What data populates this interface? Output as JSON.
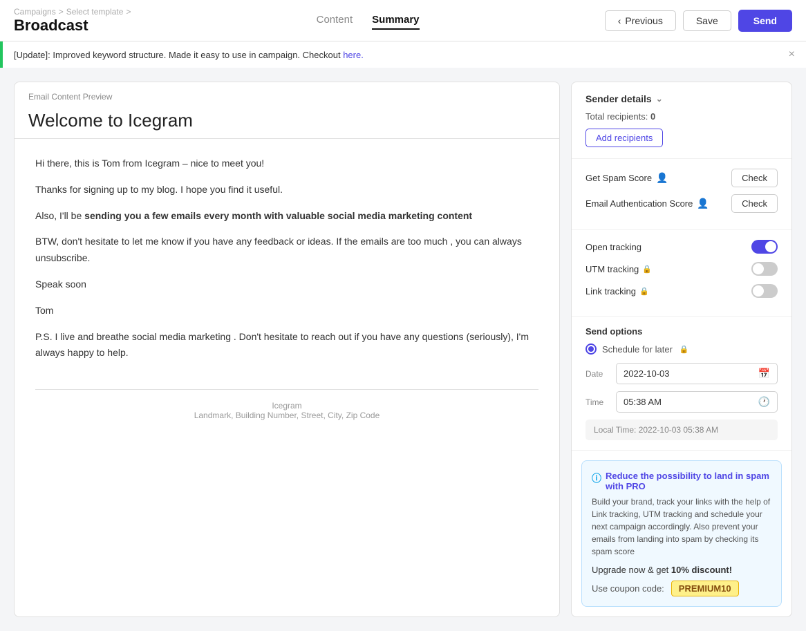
{
  "breadcrumb": {
    "campaigns": "Campaigns",
    "sep1": ">",
    "select_template": "Select template",
    "sep2": ">"
  },
  "page": {
    "title": "Broadcast"
  },
  "tabs": [
    {
      "id": "content",
      "label": "Content",
      "active": false
    },
    {
      "id": "summary",
      "label": "Summary",
      "active": true
    }
  ],
  "header_buttons": {
    "previous": "Previous",
    "save": "Save",
    "send": "Send"
  },
  "banner": {
    "text": "[Update]: Improved keyword structure. Made it easy to use in campaign. Checkout ",
    "link_text": "here.",
    "close": "×"
  },
  "preview": {
    "label": "Email Content Preview",
    "email_title": "Welcome to Icegram",
    "body_paragraphs": [
      "Hi there, this is Tom from Icegram – nice to meet you!",
      "Thanks for signing up to my blog. I hope you find it useful.",
      "",
      "BTW, don't hesitate to let me know if you have any feedback or ideas. If the emails are too much , you can always unsubscribe.",
      "Speak soon",
      "Tom",
      ""
    ],
    "bold_line": "sending you a few emails every month with valuable social media marketing content",
    "also_line": "Also, I'll be",
    "ps_line": "P.S. I live and breathe social media marketing . Don't hesitate to reach out if you have any questions (seriously), I'm always happy to help.",
    "footer_company": "Icegram",
    "footer_address": "Landmark, Building Number, Street, City, Zip Code"
  },
  "sidebar": {
    "sender_header": "Sender details",
    "total_recipients_label": "Total recipients:",
    "total_recipients_count": "0",
    "add_recipients": "Add recipients",
    "get_spam_score": "Get Spam Score",
    "email_auth_score": "Email Authentication Score",
    "check": "Check",
    "tracking": {
      "open_tracking": "Open tracking",
      "utm_tracking": "UTM tracking",
      "link_tracking": "Link tracking"
    },
    "send_options": "Send options",
    "schedule_for_later": "Schedule for later",
    "date_label": "Date",
    "date_value": "2022-10-03",
    "time_label": "Time",
    "time_value": "05:38 AM",
    "local_time_label": "Local Time:",
    "local_time_value": "2022-10-03 05:38 AM"
  },
  "pro_banner": {
    "title": "Reduce the possibility to land in spam with PRO",
    "body": "Build your brand, track your links with the help of Link tracking, UTM tracking and schedule your next campaign accordingly. Also prevent your emails from landing into spam by checking its spam score",
    "upgrade": "Upgrade now & get",
    "discount": "10% discount!",
    "coupon_label": "Use coupon code:",
    "coupon_code": "PREMIUM10"
  }
}
